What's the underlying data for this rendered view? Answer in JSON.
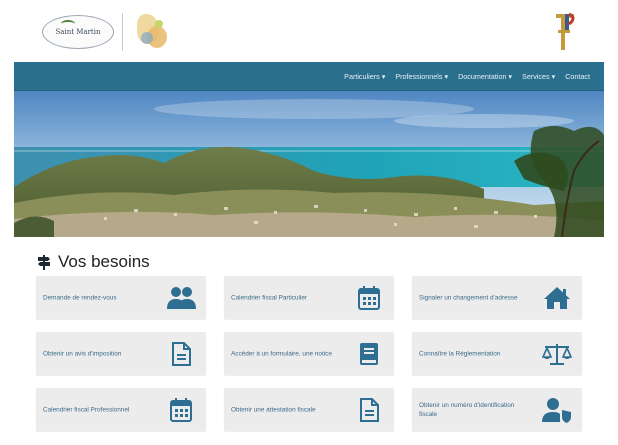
{
  "header": {
    "logo_text": "Saint Martin",
    "brand_mark": "F"
  },
  "nav": {
    "items": [
      {
        "label": "Particuliers"
      },
      {
        "label": "Professionnels"
      },
      {
        "label": "Documentation"
      },
      {
        "label": "Services"
      },
      {
        "label": "Contact"
      }
    ]
  },
  "needs": {
    "title": "Vos besoins",
    "title_icon": "signpost-icon",
    "cards": [
      {
        "label": "Demande de rendez-vous",
        "icon": "users-icon"
      },
      {
        "label": "Calendrier fiscal Particulier",
        "icon": "calendar-icon"
      },
      {
        "label": "Signaler un changement d'adresse",
        "icon": "home-icon"
      },
      {
        "label": "Obtenir un avis d'imposition",
        "icon": "document-icon"
      },
      {
        "label": "Accéder à un formulaire, une notice",
        "icon": "book-icon"
      },
      {
        "label": "Connaître la Réglementation",
        "icon": "scales-icon"
      },
      {
        "label": "Calendrier fiscal Professionnel",
        "icon": "calendar-icon"
      },
      {
        "label": "Obtenir une attestation fiscale",
        "icon": "document-icon"
      },
      {
        "label": "Obtenir un numéro d'identification fiscale",
        "icon": "user-shield-icon"
      }
    ]
  },
  "colors": {
    "navbar": "#2b6f8e",
    "card_bg": "#ececec",
    "card_text": "#3a6a8a",
    "icon": "#2e6e92"
  }
}
